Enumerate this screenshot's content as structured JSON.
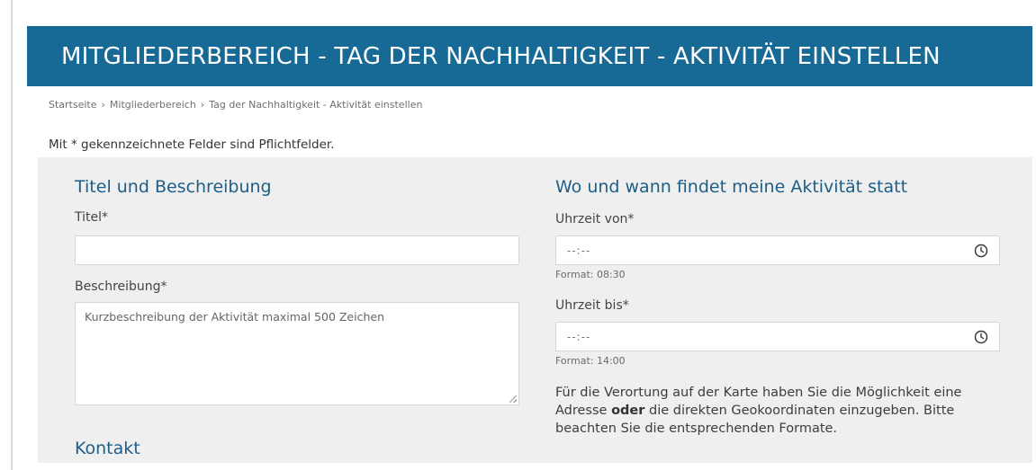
{
  "header": {
    "title": "MITGLIEDERBEREICH - TAG DER NACHHALTIGKEIT - AKTIVITÄT EINSTELLEN"
  },
  "breadcrumb": {
    "items": [
      "Startseite",
      "Mitgliederbereich",
      "Tag der Nachhaltigkeit - Aktivität einstellen"
    ],
    "separator": "›"
  },
  "required_note": "Mit * gekennzeichnete Felder sind Pflichtfelder.",
  "left_section": {
    "title": "Titel und Beschreibung",
    "title_field": {
      "label": "Titel*",
      "value": ""
    },
    "description_field": {
      "label": "Beschreibung*",
      "placeholder": "Kurzbeschreibung der Aktivität maximal 500 Zeichen",
      "value": ""
    },
    "contact_title": "Kontakt"
  },
  "right_section": {
    "title": "Wo und wann findet meine Aktivität statt",
    "time_from": {
      "label": "Uhrzeit von*",
      "value": "--:--",
      "hint": "Format: 08:30",
      "icon": "clock-icon"
    },
    "time_to": {
      "label": "Uhrzeit bis*",
      "value": "--:--",
      "hint": "Format: 14:00",
      "icon": "clock-icon"
    },
    "location_info": {
      "part1": "Für die Verortung auf der Karte haben Sie die Möglichkeit eine Adresse ",
      "bold": "oder",
      "part2": " die direkten Geokoordinaten einzugeben. Bitte beachten Sie die entsprechenden Formate."
    }
  },
  "colors": {
    "banner_background": "#186a96",
    "section_title": "#1e5e86",
    "panel_background": "#efefef"
  }
}
